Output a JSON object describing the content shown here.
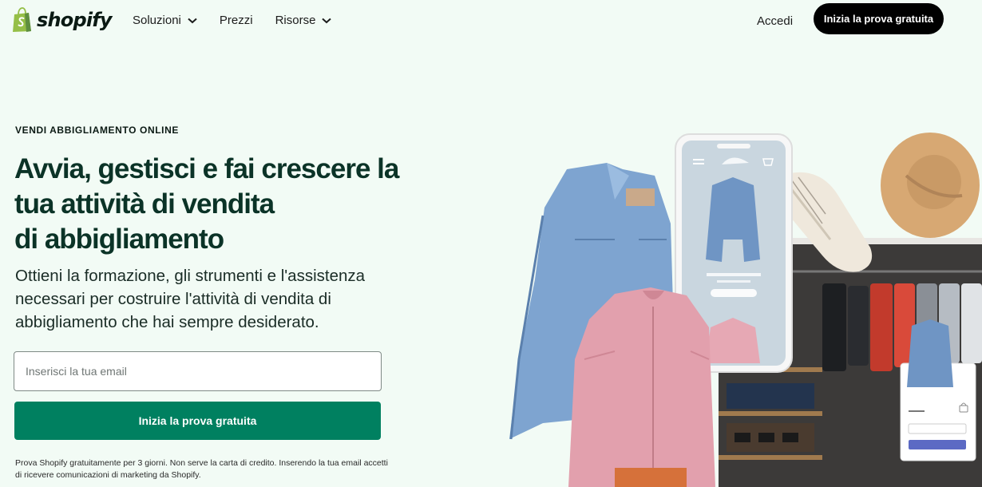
{
  "header": {
    "logo_text": "shopify",
    "nav": [
      {
        "label": "Soluzioni",
        "has_dropdown": true
      },
      {
        "label": "Prezzi",
        "has_dropdown": false
      },
      {
        "label": "Risorse",
        "has_dropdown": true
      }
    ],
    "login_label": "Accedi",
    "cta_label": "Inizia la prova gratuita"
  },
  "hero": {
    "eyebrow": "VENDI ABBIGLIAMENTO ONLINE",
    "headline_line1": "Avvia, gestisci e fai crescere la",
    "headline_line2": "tua attività di vendita",
    "headline_line3": "di abbigliamento",
    "subheadline": "Ottieni la formazione, gli strumenti e l'assistenza necessari per costruire l'attività di vendita di abbigliamento che hai sempre desiderato.",
    "email_placeholder": "Inserisci la tua email",
    "cta_label": "Inizia la prova gratuita",
    "disclaimer": "Prova Shopify gratuitamente per 3 giorni. Non serve la carta di credito. Inserendo la tua email accetti di ricevere comunicazioni di marketing da Shopify."
  },
  "colors": {
    "background": "#f2fbf5",
    "brand_green": "#008060",
    "headline": "#0b3327",
    "cta_dark": "#000000"
  },
  "icons": [
    "shopify-bag-icon",
    "chevron-down-icon",
    "hamburger-icon",
    "cart-icon",
    "lock-icon"
  ]
}
